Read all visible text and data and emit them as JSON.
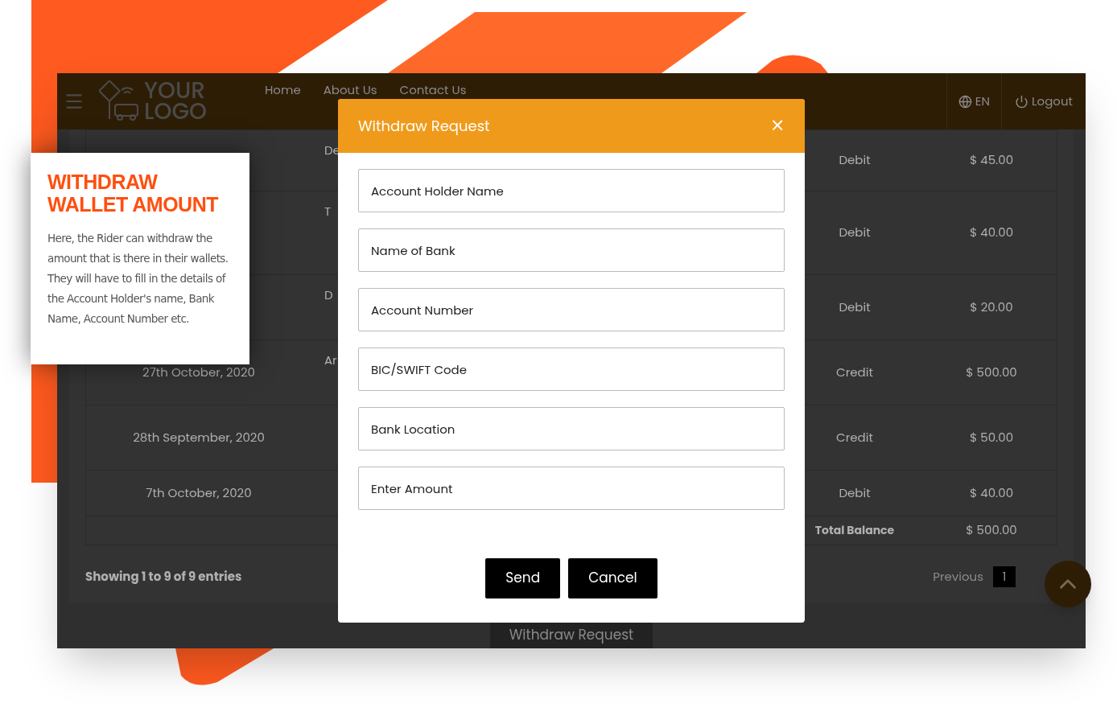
{
  "callout": {
    "title": "WITHDRAW WALLET AMOUNT",
    "body": "Here, the Rider can withdraw the amount that is there in their wallets. They will have to fill in the details of the Account Holder's name, Bank Name, Account Number etc."
  },
  "header": {
    "logo_line_1": "YOUR",
    "logo_line_2": "LOGO",
    "nav": [
      "Home",
      "About Us",
      "Contact Us"
    ],
    "language": "EN",
    "logout": "Logout"
  },
  "table": {
    "rows": [
      {
        "description": "De",
        "type": "Debit",
        "amount": "$ 45.00"
      },
      {
        "description": "T",
        "type": "Debit",
        "amount": "$ 40.00"
      },
      {
        "description": "D",
        "type": "Debit",
        "amount": "$ 20.00"
      },
      {
        "date": "27th October, 2020",
        "description": "Ar",
        "type": "Credit",
        "amount": "$ 500.00"
      },
      {
        "date": "28th September, 2020",
        "description": "",
        "type": "Credit",
        "amount": "$ 50.00"
      },
      {
        "date": "7th October, 2020",
        "description": "",
        "type": "Debit",
        "amount": "$ 40.00"
      }
    ],
    "total_label": "Total Balance",
    "total_amount": "$ 500.00"
  },
  "footer": {
    "entries": "Showing 1 to 9 of 9 entries",
    "previous": "Previous",
    "pages": [
      {
        "label": "1",
        "selected": true
      }
    ],
    "withdraw_button": "Withdraw Request"
  },
  "modal": {
    "title": "Withdraw Request",
    "close": "×",
    "fields": [
      {
        "placeholder": "Account Holder Name"
      },
      {
        "placeholder": "Name of Bank"
      },
      {
        "placeholder": "Account Number"
      },
      {
        "placeholder": "BIC/SWIFT Code"
      },
      {
        "placeholder": "Bank Location"
      },
      {
        "placeholder": "Enter Amount"
      }
    ],
    "buttons": [
      "Send",
      "Cancel"
    ]
  }
}
